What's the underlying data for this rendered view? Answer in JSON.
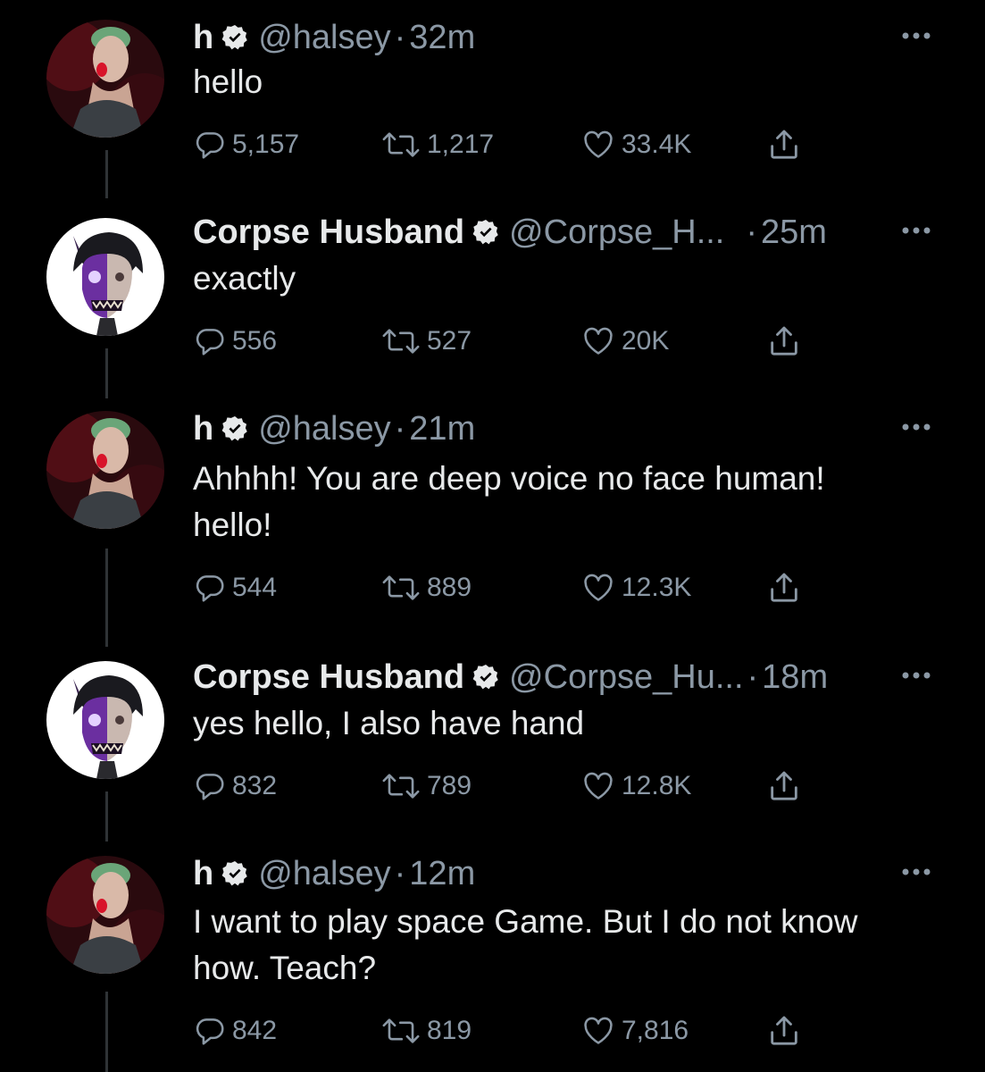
{
  "tweets": [
    {
      "name": "h",
      "handle": "@halsey",
      "separator": "·",
      "time": "32m",
      "lines": [
        "hello"
      ],
      "replies": "5,157",
      "retweets": "1,217",
      "likes": "33.4K",
      "avatar": "halsey-avatar",
      "verified": true
    },
    {
      "name": "Corpse Husband",
      "handle": "@Corpse_H...",
      "separator": "·",
      "time": "25m",
      "lines": [
        "exactly"
      ],
      "replies": "556",
      "retweets": "527",
      "likes": "20K",
      "avatar": "corpse-avatar",
      "verified": true
    },
    {
      "name": "h",
      "handle": "@halsey",
      "separator": "·",
      "time": "21m",
      "lines": [
        "Ahhhh! You are deep voice no face human!",
        "hello!"
      ],
      "replies": "544",
      "retweets": "889",
      "likes": "12.3K",
      "avatar": "halsey-avatar",
      "verified": true
    },
    {
      "name": "Corpse Husband",
      "handle": "@Corpse_Hu...",
      "separator": "·",
      "time": "18m",
      "lines": [
        "yes hello, I also have hand"
      ],
      "replies": "832",
      "retweets": "789",
      "likes": "12.8K",
      "avatar": "corpse-avatar",
      "verified": true
    },
    {
      "name": "h",
      "handle": "@halsey",
      "separator": "·",
      "time": "12m",
      "lines": [
        "I want to play space Game. But I do not know",
        "how. Teach?"
      ],
      "replies": "842",
      "retweets": "819",
      "likes": "7,816",
      "avatar": "halsey-avatar",
      "verified": true
    }
  ],
  "icons": {
    "reply": "reply-icon",
    "retweet": "retweet-icon",
    "like": "heart-icon",
    "share": "share-icon",
    "more": "more-icon",
    "verified": "verified-badge-icon"
  },
  "colors": {
    "background": "#000000",
    "text": "#e7e9ea",
    "secondary": "#8b98a5",
    "thread_line": "#2f3336"
  }
}
